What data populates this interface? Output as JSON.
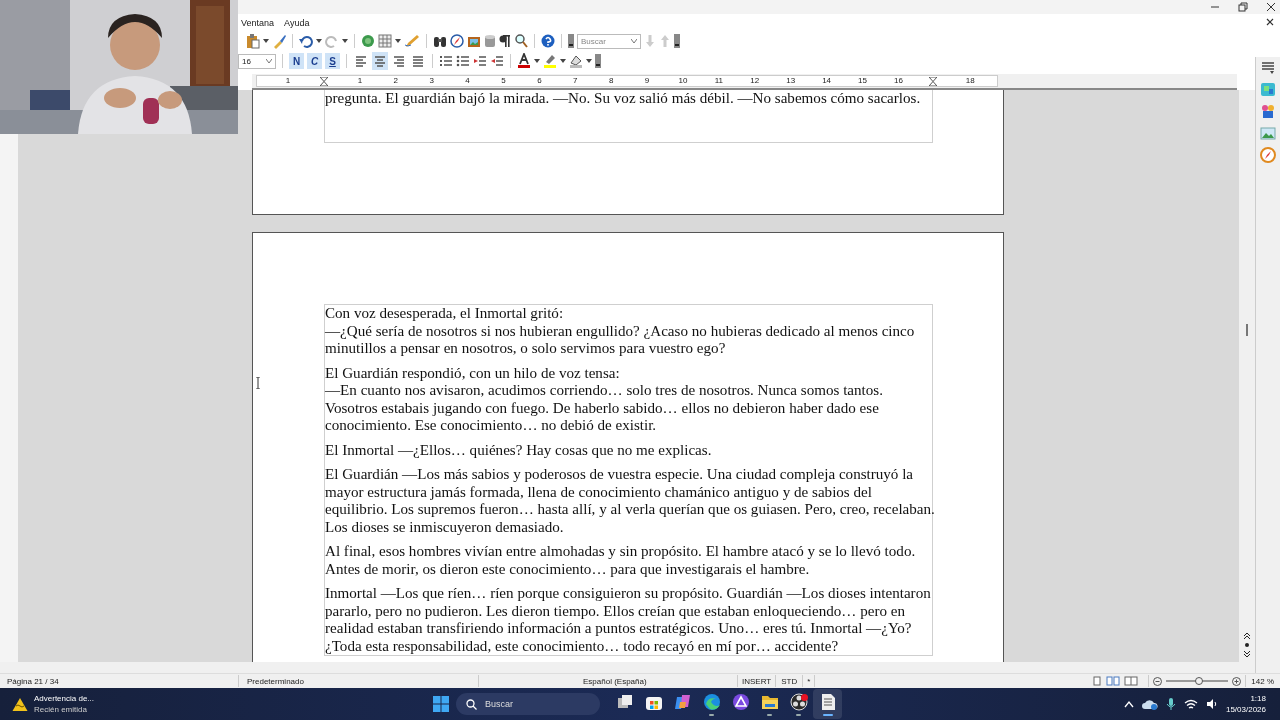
{
  "menu": [
    "Ventana",
    "Ayuda"
  ],
  "toolbar": {
    "search_placeholder": "Buscar",
    "font_size": "16",
    "format_buttons": [
      {
        "label": "N",
        "on": true
      },
      {
        "label": "C",
        "on": true
      },
      {
        "label": "S",
        "on": true
      }
    ],
    "align_buttons": [
      {
        "on": false
      },
      {
        "on": true
      },
      {
        "on": false
      },
      {
        "on": false
      }
    ]
  },
  "ruler": {
    "labels": [
      "1",
      "1",
      "2",
      "3",
      "4",
      "5",
      "6",
      "7",
      "8",
      "9",
      "10",
      "11",
      "12",
      "13",
      "14",
      "15",
      "16",
      "18"
    ]
  },
  "document": {
    "previous_page_line": "pregunta. El guardián bajó la mirada. —No. Su voz salió más débil. —No sabemos cómo sacarlos.",
    "paragraphs": [
      [
        "Con voz desesperada, el Inmortal gritó:",
        "—¿Qué sería de nosotros si nos hubieran engullido? ¿Acaso no hubieras dedicado al menos cinco minutillos a pensar en nosotros, o solo servimos para vuestro ego?"
      ],
      [
        "El Guardián respondió, con un hilo de voz tensa:",
        "—En cuanto nos avisaron, acudimos corriendo… solo tres de nosotros. Nunca somos tantos. Vosotros estabais jugando con fuego. De haberlo sabido… ellos no debieron haber dado ese conocimiento. Ese conocimiento… no debió de existir."
      ],
      [
        "El Inmortal —¿Ellos… quiénes? Hay cosas que no me explicas."
      ],
      [
        "El Guardián —Los más sabios y poderosos de vuestra especie. Una ciudad compleja construyó la mayor estructura jamás formada, llena de conocimiento chamánico antiguo y de sabios del equilibrio. Los supremos fueron… hasta allí, y al verla querían que os guiasen. Pero, creo, recelaban. Los dioses se inmiscuyeron demasiado."
      ],
      [
        "Al final, esos hombres vivían entre almohadas y sin propósito. El hambre atacó y se lo llevó todo. Antes de morir, os dieron este conocimiento… para que investigarais el hambre."
      ],
      [
        "Inmortal —Los que ríen… ríen porque consiguieron su propósito. Guardián —Los dioses intentaron pararlo, pero no pudieron. Les dieron tiempo. Ellos creían que estaban enloqueciendo… pero en realidad estaban transfiriendo información a puntos estratégicos. Uno… eres tú. Inmortal —¿Yo? ¿Toda esta responsabilidad, este conocimiento… todo recayó en mí por… accidente?"
      ]
    ]
  },
  "status_bar": {
    "page": "Página 21 / 34",
    "style": "Predeterminado",
    "language": "Español (España)",
    "mode": "INSERT",
    "selection": "STD",
    "modified": "*",
    "zoom": "142 %",
    "zoom_slider": {
      "level": 0.53
    }
  },
  "taskbar": {
    "notification_title": "Advertencia de...",
    "notification_subtitle": "Recién emitida",
    "search_placeholder": "Buscar",
    "time": "1:18",
    "date": "15/03/2026",
    "apps": [
      {
        "kind": "tasks",
        "running": false,
        "selected": false
      },
      {
        "kind": "store",
        "running": false,
        "selected": false
      },
      {
        "kind": "copilot",
        "running": false,
        "selected": false
      },
      {
        "kind": "edge",
        "running": true,
        "selected": false
      },
      {
        "kind": "proton",
        "running": false,
        "selected": false
      },
      {
        "kind": "folder",
        "running": true,
        "selected": false
      },
      {
        "kind": "obs",
        "running": true,
        "selected": false
      },
      {
        "kind": "writer",
        "running": true,
        "selected": true
      }
    ]
  }
}
